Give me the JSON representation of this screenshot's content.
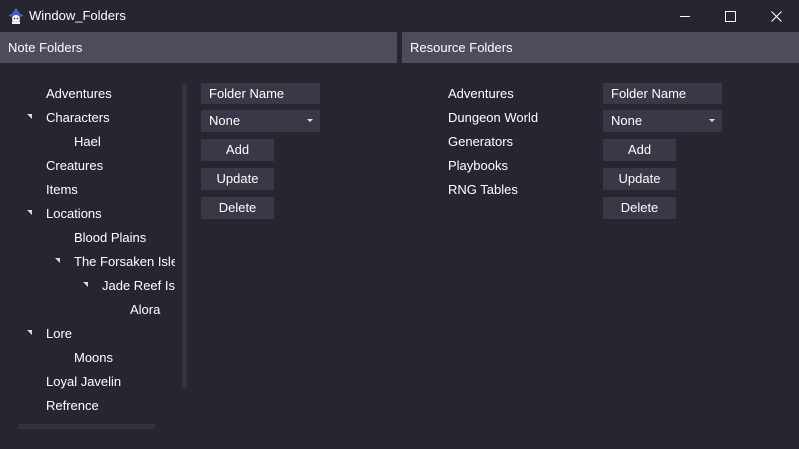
{
  "window": {
    "title": "Window_Folders",
    "icon": "wizard-hat-icon"
  },
  "note_folders": {
    "header": "Note Folders",
    "tree": [
      {
        "label": "Adventures",
        "level": 0,
        "expanded": false,
        "has_children": false
      },
      {
        "label": "Characters",
        "level": 0,
        "expanded": true,
        "has_children": true
      },
      {
        "label": "Hael",
        "level": 1,
        "expanded": false,
        "has_children": false
      },
      {
        "label": "Creatures",
        "level": 0,
        "expanded": false,
        "has_children": false
      },
      {
        "label": "Items",
        "level": 0,
        "expanded": false,
        "has_children": false
      },
      {
        "label": "Locations",
        "level": 0,
        "expanded": true,
        "has_children": true
      },
      {
        "label": "Blood Plains",
        "level": 1,
        "expanded": false,
        "has_children": false
      },
      {
        "label": "The Forsaken Isles",
        "level": 1,
        "expanded": true,
        "has_children": true
      },
      {
        "label": "Jade Reef Island",
        "level": 2,
        "expanded": true,
        "has_children": true
      },
      {
        "label": "Alora",
        "level": 3,
        "expanded": false,
        "has_children": false
      },
      {
        "label": "Lore",
        "level": 0,
        "expanded": true,
        "has_children": true
      },
      {
        "label": "Moons",
        "level": 1,
        "expanded": false,
        "has_children": false
      },
      {
        "label": "Loyal Javelin",
        "level": 0,
        "expanded": false,
        "has_children": false
      },
      {
        "label": "Refrence",
        "level": 0,
        "expanded": false,
        "has_children": false
      }
    ],
    "form": {
      "folder_name_value": "Folder Name",
      "parent_select_value": "None",
      "add_label": "Add",
      "update_label": "Update",
      "delete_label": "Delete"
    }
  },
  "resource_folders": {
    "header": "Resource Folders",
    "items": [
      "Adventures",
      "Dungeon World",
      "Generators",
      "Playbooks",
      "RNG Tables"
    ],
    "form": {
      "folder_name_value": "Folder Name",
      "parent_select_value": "None",
      "add_label": "Add",
      "update_label": "Update",
      "delete_label": "Delete"
    }
  },
  "colors": {
    "background": "#262630",
    "header": "#4c4c5c",
    "control": "#383846",
    "text": "#ffffff"
  }
}
